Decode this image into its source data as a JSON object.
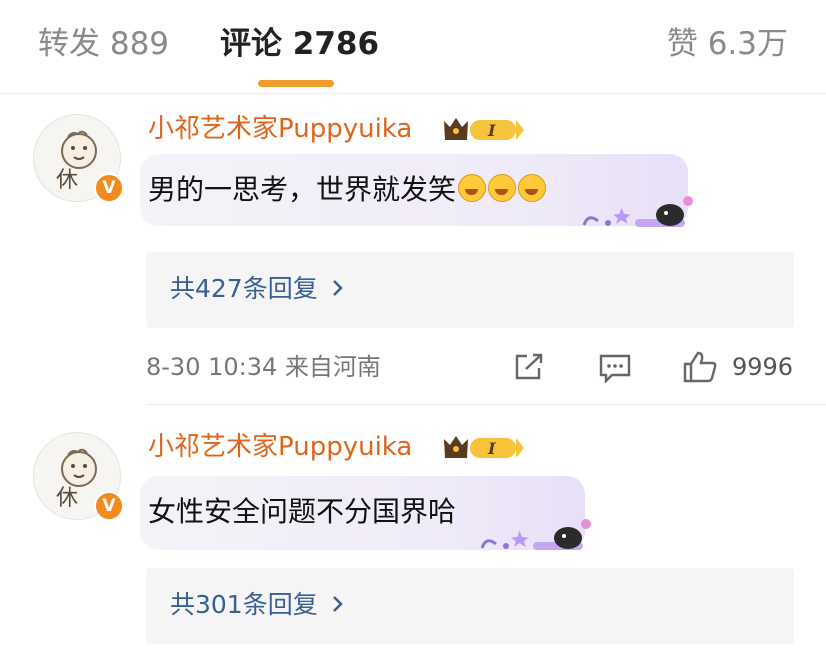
{
  "tabs": {
    "repost": "转发 889",
    "comments": "评论 2786",
    "likes": "赞 6.3万"
  },
  "comments": [
    {
      "username": "小祁艺术家Puppyuika",
      "level": "I",
      "text": "男的一思考，世界就发笑",
      "replies": "共427条回复",
      "time_location": "8-30 10:34  来自河南",
      "like_count": "9996"
    },
    {
      "username": "小祁艺术家Puppyuika",
      "level": "I",
      "text": "女性安全问题不分国界哈",
      "replies": "共301条回复"
    }
  ],
  "colors": {
    "accent": "#f29b2e",
    "username": "#e0651b",
    "reply_link": "#3a5f93"
  },
  "icons": [
    "verified-badge-icon",
    "crown-level-icon",
    "laugh-cry-emoji-icon",
    "chevron-right-icon",
    "share-icon",
    "comment-icon",
    "thumbs-up-icon"
  ]
}
